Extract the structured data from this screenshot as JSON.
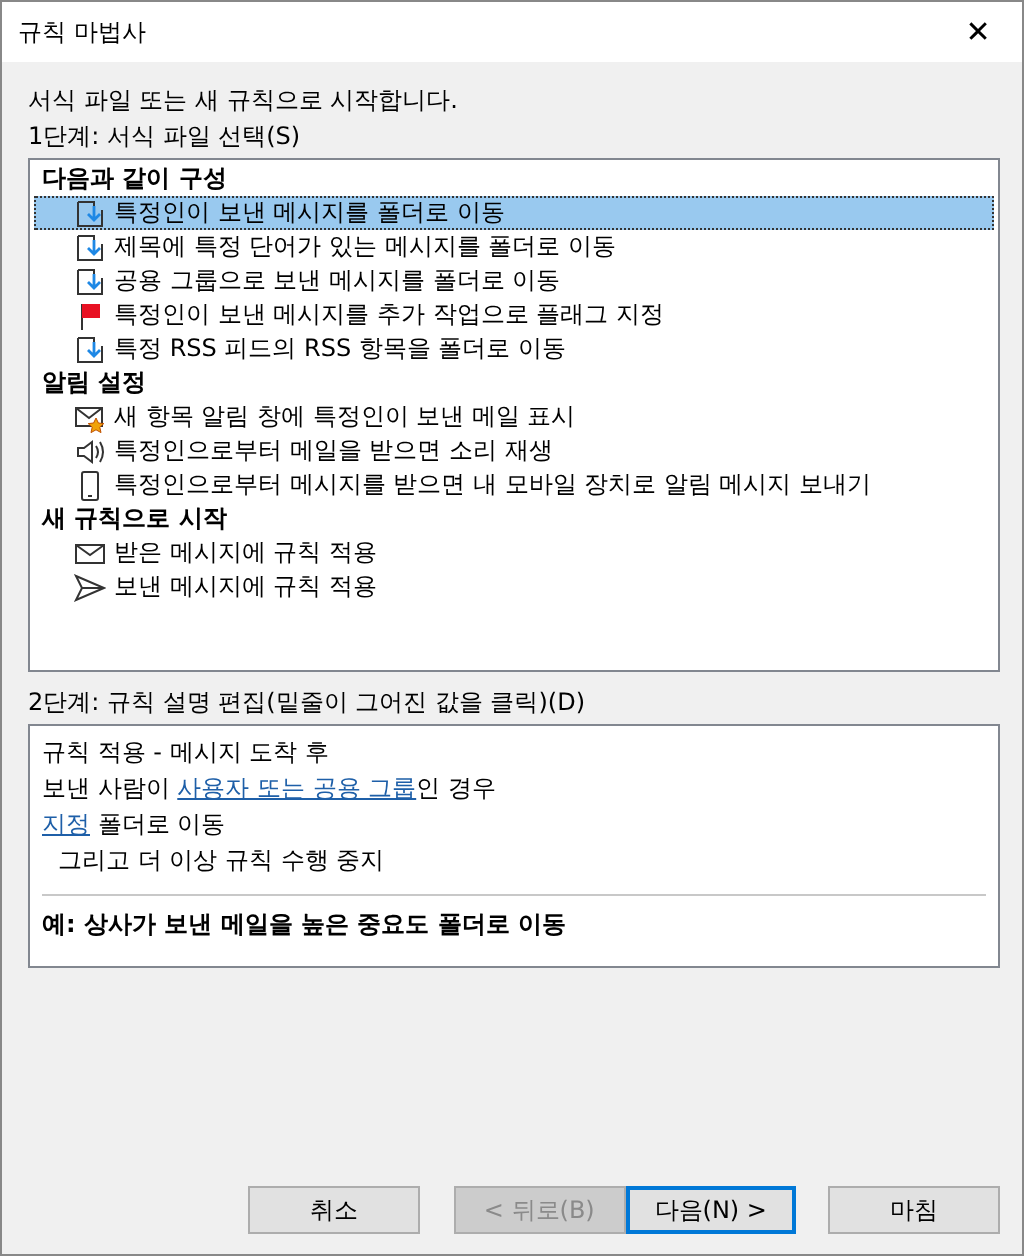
{
  "window": {
    "title": "규칙 마법사",
    "close": "✕"
  },
  "intro": "서식 파일 또는 새 규칙으로 시작합니다.",
  "step1": "1단계: 서식 파일 선택(S)",
  "template_groups": [
    {
      "title": "다음과 같이 구성",
      "items": [
        {
          "label": "특정인이 보낸 메시지를 폴더로 이동",
          "kind": "move",
          "selected": true
        },
        {
          "label": "제목에 특정 단어가 있는 메시지를 폴더로 이동",
          "kind": "move",
          "selected": false
        },
        {
          "label": "공용 그룹으로 보낸 메시지를 폴더로 이동",
          "kind": "move",
          "selected": false
        },
        {
          "label": "특정인이 보낸 메시지를 추가 작업으로 플래그 지정",
          "kind": "flag",
          "selected": false
        },
        {
          "label": "특정 RSS 피드의 RSS 항목을 폴더로 이동",
          "kind": "move",
          "selected": false
        }
      ]
    },
    {
      "title": "알림 설정",
      "items": [
        {
          "label": "새 항목 알림 창에 특정인이 보낸 메일 표시",
          "kind": "alert",
          "selected": false
        },
        {
          "label": "특정인으로부터 메일을 받으면 소리 재생",
          "kind": "sound",
          "selected": false
        },
        {
          "label": "특정인으로부터 메시지를 받으면 내 모바일 장치로 알림 메시지 보내기",
          "kind": "mobile",
          "selected": false
        }
      ]
    },
    {
      "title": "새 규칙으로 시작",
      "items": [
        {
          "label": "받은 메시지에 규칙 적용",
          "kind": "envelope",
          "selected": false
        },
        {
          "label": "보낸 메시지에 규칙 적용",
          "kind": "send",
          "selected": false
        }
      ]
    }
  ],
  "step2": "2단계: 규칙 설명 편집(밑줄이 그어진 값을 클릭)(D)",
  "description_lines": [
    {
      "indent": false,
      "segments": [
        {
          "kind": "text",
          "text": "규칙 적용 - 메시지 도착 후"
        }
      ]
    },
    {
      "indent": false,
      "segments": [
        {
          "kind": "text",
          "text": "보낸 사람이 "
        },
        {
          "kind": "link",
          "text": "사용자 또는 공용 그룹"
        },
        {
          "kind": "text",
          "text": "인 경우"
        }
      ]
    },
    {
      "indent": false,
      "segments": [
        {
          "kind": "link",
          "text": "지정"
        },
        {
          "kind": "text",
          "text": " 폴더로 이동"
        }
      ]
    },
    {
      "indent": true,
      "segments": [
        {
          "kind": "text",
          "text": "그리고 더 이상 규칙 수행 중지"
        }
      ]
    }
  ],
  "example": "예: 상사가 보낸 메일을 높은 중요도 폴더로 이동",
  "buttons": [
    {
      "label": "취소",
      "disabled": false,
      "default": false
    },
    {
      "label": "< 뒤로(B)",
      "disabled": true,
      "default": false
    },
    {
      "label": "다음(N) >",
      "disabled": false,
      "default": true
    },
    {
      "label": "마침",
      "disabled": false,
      "default": false
    }
  ]
}
